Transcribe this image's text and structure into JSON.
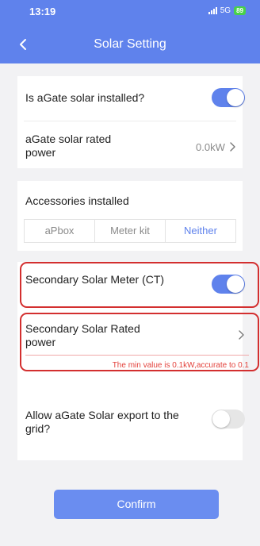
{
  "status_bar": {
    "time": "13:19",
    "network": "5G",
    "battery": "89"
  },
  "header": {
    "title": "Solar Setting"
  },
  "solar_card": {
    "installed_label": "Is aGate solar installed?",
    "installed_on": true,
    "rated_power_label": "aGate solar rated power",
    "rated_power_value": "0.0kW"
  },
  "accessories": {
    "label": "Accessories installed",
    "options": [
      "aPbox",
      "Meter kit",
      "Neither"
    ],
    "selected": "Neither"
  },
  "secondary": {
    "meter_label": "Secondary Solar Meter (CT)",
    "meter_on": true,
    "rated_power_label": "Secondary Solar Rated power",
    "error_text": "The min value is 0.1kW,accurate to 0.1"
  },
  "export": {
    "label": "Allow aGate Solar export to the grid?",
    "on": false
  },
  "confirm_label": "Confirm",
  "colors": {
    "accent": "#5f82ec",
    "error": "#e3413b",
    "highlight": "#d32f2f"
  }
}
